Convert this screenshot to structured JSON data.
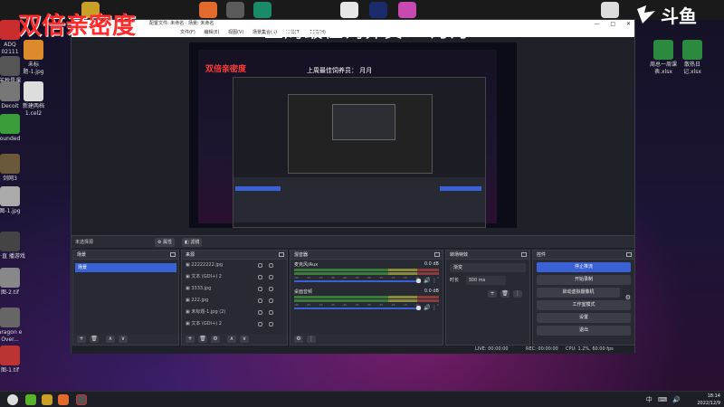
{
  "overlay": {
    "title": "双倍亲密度",
    "subtitle": "上周最佳饲养员：  月月",
    "brand": "斗鱼"
  },
  "desktop_icons_left": [
    {
      "label": "ADQ 02111",
      "icon": "app-icon"
    },
    {
      "label": "羊税是课",
      "icon": "app-icon"
    },
    {
      "label": "Decoit",
      "icon": "app-icon"
    },
    {
      "label": "ounded",
      "icon": "app-icon"
    },
    {
      "label": "剑网3",
      "icon": "app-icon"
    },
    {
      "label": "图-1.jpg",
      "icon": "image-icon"
    },
    {
      "label": "葱·直 播游戏",
      "icon": "app-icon"
    },
    {
      "label": "图-2.tif",
      "icon": "image-icon"
    },
    {
      "label": "aragon e Over...",
      "icon": "app-icon"
    },
    {
      "label": "图-1.tif",
      "icon": "image-icon"
    }
  ],
  "desktop_icons_mid": [
    {
      "label": "未标题-1.jpg",
      "icon": "image-icon"
    },
    {
      "label": "新建两档 1.cel2",
      "icon": "file-icon"
    }
  ],
  "desktop_icons_right": [
    {
      "label": "周总一周课 表.xlsx",
      "icon": "excel-icon"
    },
    {
      "label": "散热日记.xlsx",
      "icon": "excel-icon"
    }
  ],
  "obs": {
    "title_bar": "配置文件: 未命名 · 场景: 未命名",
    "window_controls": [
      "—",
      "□",
      "✕"
    ],
    "menu": [
      "文件(F)",
      "编辑(E)",
      "视图(V)",
      "场景集合(S)",
      "工具(T)",
      "帮助(H)"
    ],
    "nested_overlay_title": "双倍亲密度",
    "nested_overlay_subtitle": "上周最佳饲养员：  月月",
    "toolbar": {
      "no_source_selected": "未选择源",
      "properties_label": "属性",
      "filters_label": "滤镜"
    },
    "scenes": {
      "header": "场景",
      "items": [
        "场景"
      ]
    },
    "sources": {
      "header": "来源",
      "items": [
        "22222222.jpg",
        "文本 (GDI+) 2",
        "3333.jpg",
        "222.jpg",
        "未标题-1.jpg (2)",
        "文本 (GDI+) 2"
      ]
    },
    "mixer": {
      "header": "混音器",
      "channels": [
        {
          "name": "麦克风/Aux",
          "db": "0.0 dB",
          "level": 0.62
        },
        {
          "name": "桌面音频",
          "db": "0.0 dB",
          "level": 0.62
        }
      ],
      "ticks": [
        "-60",
        "-55",
        "-50",
        "-45",
        "-40",
        "-35",
        "-30",
        "-25",
        "-20",
        "-15",
        "-10",
        "-5",
        "0"
      ]
    },
    "transitions": {
      "header": "转场特效",
      "selected": "渐变",
      "duration_label": "时长",
      "duration_value": "300 ms"
    },
    "controls": {
      "header": "控件",
      "buttons": [
        "停止推流",
        "开始录制",
        "启动虚拟摄像机",
        "工作室模式",
        "设置",
        "退出"
      ]
    },
    "status": {
      "live": "LIVE: 00:00:00",
      "rec": "REC: 00:00:00",
      "cpu": "CPU: 1.2%, 60.00 fps"
    }
  },
  "taskbar": {
    "tray_text": "中 ⌨ 🔊",
    "time": "18:14",
    "date": "2022/12/9"
  },
  "colors": {
    "accent": "#3a62d6",
    "overlay_red": "#ff2a2a",
    "obs_bg": "#1f2128"
  }
}
